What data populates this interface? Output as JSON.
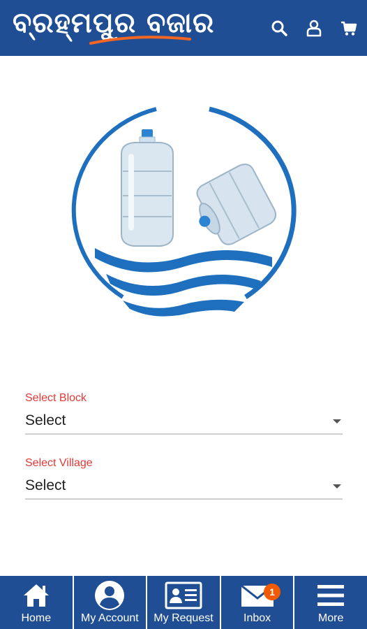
{
  "header": {
    "logo_text": "ବ୍ରହ୍ମପୁର ବଜାର",
    "icons": [
      "search-icon",
      "user-icon",
      "cart-icon"
    ],
    "brand_color": "#1f4e94",
    "swoosh_color": "#f26522"
  },
  "hero": {
    "image": "water-bottles-logo",
    "accent_color": "#1f6fbf"
  },
  "form": {
    "block": {
      "label": "Select Block",
      "value": "Select"
    },
    "village": {
      "label": "Select Village",
      "value": "Select"
    },
    "label_color": "#e53935"
  },
  "bottom_nav": {
    "items": [
      {
        "label": "Home",
        "icon": "home-icon"
      },
      {
        "label": "My Account",
        "icon": "account-icon"
      },
      {
        "label": "My Request",
        "icon": "id-card-icon"
      },
      {
        "label": "Inbox",
        "icon": "mail-icon",
        "badge": "1"
      },
      {
        "label": "More",
        "icon": "menu-icon"
      }
    ]
  }
}
